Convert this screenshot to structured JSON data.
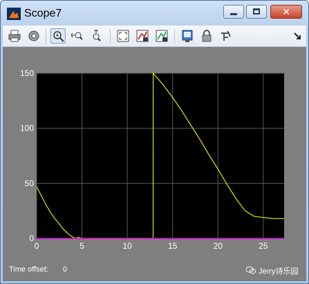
{
  "window": {
    "title": "Scope7",
    "close_glyph": "✕"
  },
  "toolbar": {
    "buttons": [
      {
        "name": "print-icon"
      },
      {
        "name": "parameters-icon"
      },
      {
        "name": "zoom-in-icon",
        "active": true
      },
      {
        "name": "zoom-x-icon"
      },
      {
        "name": "zoom-y-icon"
      },
      {
        "name": "autoscale-icon"
      },
      {
        "name": "save-axes-settings-icon"
      },
      {
        "name": "restore-axes-settings-icon"
      },
      {
        "name": "floating-scope-icon"
      },
      {
        "name": "lock-axes-icon"
      },
      {
        "name": "signal-selection-icon"
      },
      {
        "name": "dock-arrow-icon"
      }
    ]
  },
  "status": {
    "time_offset_label": "Time offset:",
    "time_offset_value": "0"
  },
  "watermark": {
    "text": "Jerry诗乐园"
  },
  "chart_data": {
    "type": "line",
    "xlim": [
      0,
      27.3
    ],
    "ylim": [
      0,
      150
    ],
    "x_ticks": [
      "0",
      "5",
      "10",
      "15",
      "20",
      "25"
    ],
    "y_ticks": [
      "0",
      "50",
      "100",
      "150"
    ],
    "grid": true,
    "background": "#000000",
    "series": [
      {
        "color": "#e6e600",
        "x": [
          0,
          0.5,
          1,
          1.5,
          2,
          2.5,
          3,
          3.5,
          4,
          4.3,
          4.6,
          5,
          5.05,
          12.85,
          12.86,
          13.5,
          14,
          15,
          16,
          17,
          18,
          19,
          20,
          21,
          22,
          23,
          24,
          25,
          26,
          27.3
        ],
        "y": [
          47,
          39,
          31,
          24,
          18,
          13,
          8,
          4,
          1,
          0,
          1,
          0,
          0,
          0,
          150,
          144,
          139,
          128,
          116,
          103,
          90,
          76,
          63,
          49,
          36,
          25,
          20,
          19,
          18,
          18
        ]
      },
      {
        "color": "#e600e6",
        "x": [
          0,
          27.3
        ],
        "y": [
          0,
          0
        ]
      }
    ]
  },
  "colors": {
    "plot_line": "#e6e600",
    "zero_line": "#e600e6",
    "grid": "#5a5a5a",
    "axes_text": "#ffffff",
    "figure_bg": "#7f7f7f"
  }
}
